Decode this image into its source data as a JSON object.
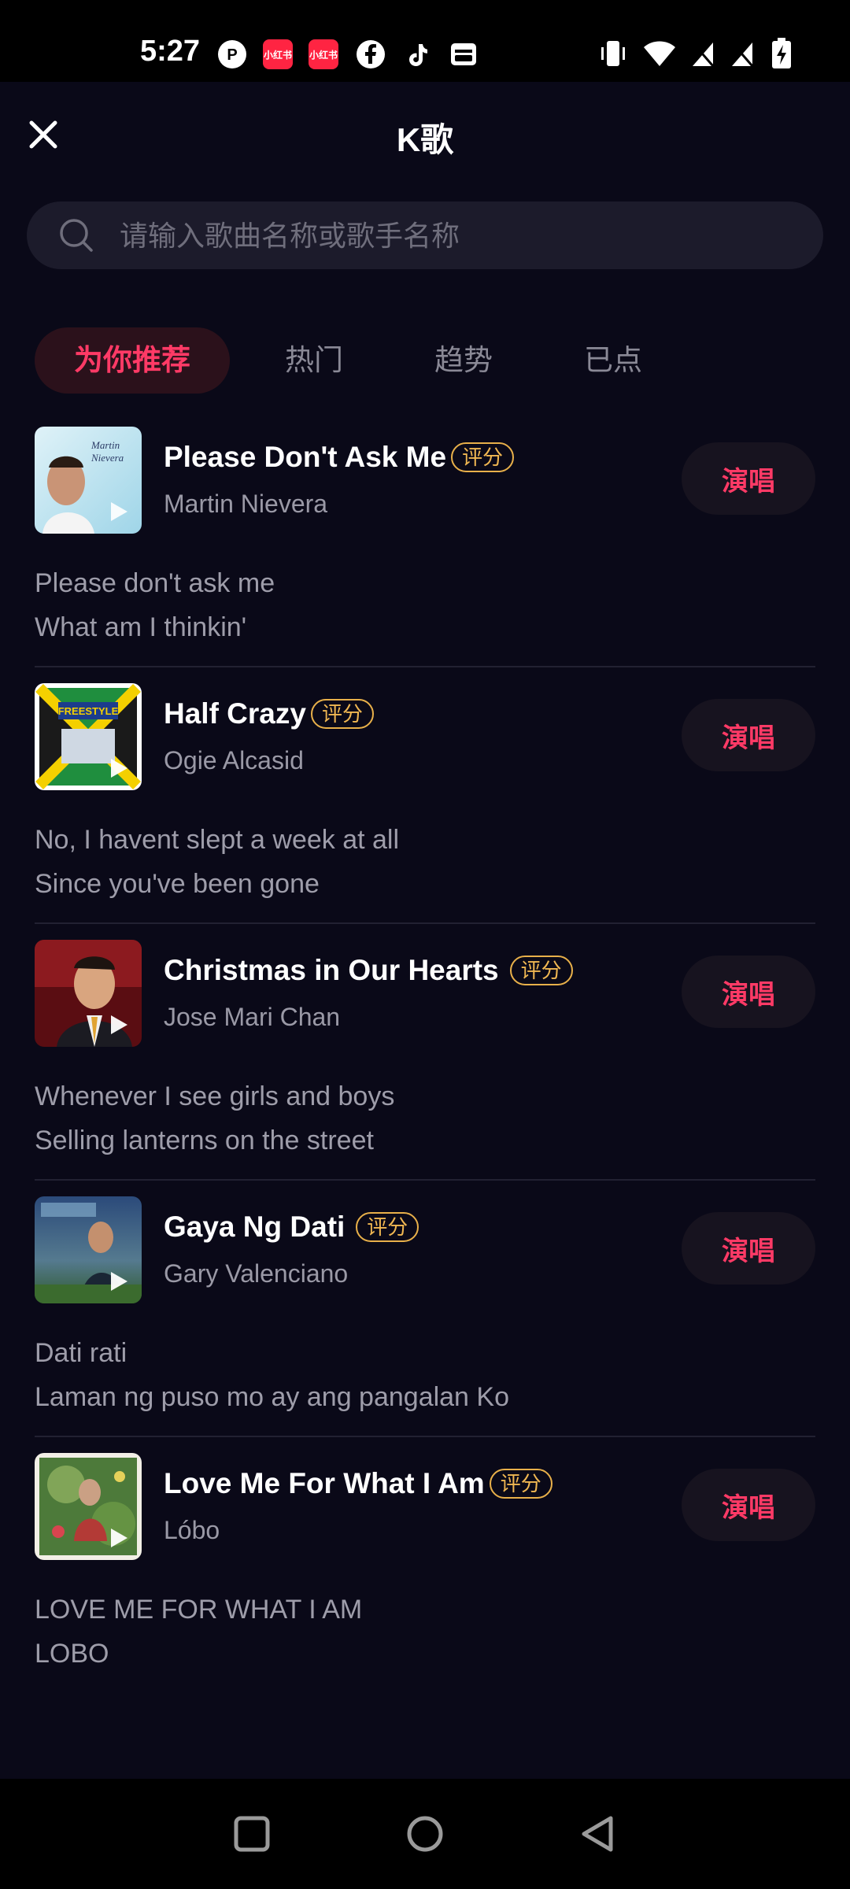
{
  "status_bar": {
    "time": "5:27",
    "red_icon_1": "小红书",
    "red_icon_2": "小红书"
  },
  "header": {
    "title": "K歌"
  },
  "search": {
    "placeholder": "请输入歌曲名称或歌手名称"
  },
  "tabs": [
    {
      "label": "为你推荐"
    },
    {
      "label": "热门"
    },
    {
      "label": "趋势"
    },
    {
      "label": "已点"
    }
  ],
  "badge_label": "评分",
  "sing_label": "演唱",
  "songs": [
    {
      "title": "Please Don't Ask Me",
      "artist": "Martin Nievera",
      "cover_text": "Martin Nievera",
      "lyric_1": "Please don't ask me",
      "lyric_2": "What am I thinkin'"
    },
    {
      "title": "Half Crazy",
      "artist": "Ogie Alcasid",
      "cover_text": "FREESTYLE",
      "lyric_1": "No, I havent slept a week at all",
      "lyric_2": "Since you've been gone"
    },
    {
      "title": "Christmas in Our Hearts",
      "artist": "Jose Mari Chan",
      "cover_text": "",
      "lyric_1": "Whenever I see girls and boys",
      "lyric_2": "Selling lanterns on the street"
    },
    {
      "title": "Gaya Ng Dati",
      "artist": "Gary Valenciano",
      "cover_text": "",
      "lyric_1": "Dati rati",
      "lyric_2": "Laman ng puso mo ay ang pangalan Ko"
    },
    {
      "title": "Love Me For What I Am",
      "artist": "Lóbo",
      "cover_text": "",
      "lyric_1": "LOVE ME FOR WHAT I AM",
      "lyric_2": "LOBO"
    }
  ],
  "colors": {
    "accent": "#ff3a66",
    "badge": "#f0b752",
    "background": "#0a0918"
  }
}
